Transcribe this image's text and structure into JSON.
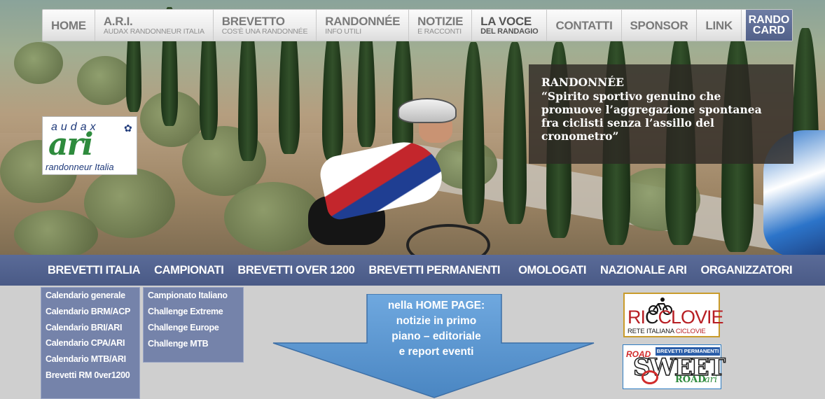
{
  "top_nav": [
    {
      "main": "HOME",
      "sub": ""
    },
    {
      "main": "A.R.I.",
      "sub": "AUDAX RANDONNEUR ITALIA"
    },
    {
      "main": "BREVETTO",
      "sub": "COS'È UNA RANDONNÉE"
    },
    {
      "main": "RANDONNÉE",
      "sub": "INFO UTILI"
    },
    {
      "main": "NOTIZIE",
      "sub": "E RACCONTI"
    },
    {
      "main": "LA VOCE",
      "sub": "DEL RANDAGIO"
    },
    {
      "main": "CONTATTI",
      "sub": ""
    },
    {
      "main": "SPONSOR",
      "sub": ""
    },
    {
      "main": "LINK",
      "sub": ""
    }
  ],
  "rando_card": {
    "line1": "RANDO",
    "line2": "CARD"
  },
  "logo": {
    "top": "audax",
    "main": "ari",
    "bottom": "randonneur Italia"
  },
  "quote": {
    "title": "RANDONNÉE",
    "text": "“Spirito sportivo genuino che promuove l’aggregazione spontanea fra ciclisti senza l’assillo del cronometro”"
  },
  "section_nav": [
    "BREVETTI ITALIA",
    "CAMPIONATI",
    "BREVETTI OVER 1200",
    "BREVETTI PERMANENTI",
    "OMOLOGATI",
    "NAZIONALE ARI",
    "ORGANIZZATORI"
  ],
  "dropdown_brevetti_italia": [
    "Calendario generale",
    "Calendario BRM/ACP",
    "Calendario BRI/ARI",
    "Calendario CPA/ARI",
    "Calendario MTB/ARI",
    "Brevetti RM 0ver1200"
  ],
  "dropdown_campionati": [
    "Campionato Italiano",
    "Challenge Extreme",
    "Challenge Europe",
    "Challenge MTB"
  ],
  "callout": {
    "line1": "nella HOME PAGE:",
    "line2": "notizie in primo",
    "line3": "piano – editoriale",
    "line4": "e report eventi"
  },
  "sponsors": {
    "ricclovie": {
      "name_a": "RI",
      "name_b": "C",
      "name_c": "CLOVIE",
      "sub_a": "RETE ITALIANA ",
      "sub_b": "CICLOVIE"
    },
    "roadsweet": {
      "road_top": "ROAD",
      "banner": "BREVETTI PERMANENTI",
      "sweet": "SWEET",
      "road_bottom": "ROAD",
      "ari": "ari"
    }
  },
  "colors": {
    "section_nav_bg": "#4e5e8b",
    "dropdown_bg": "#7583aa",
    "callout_fill": "#5b9bd5",
    "quote_bg": "#2d2823"
  }
}
